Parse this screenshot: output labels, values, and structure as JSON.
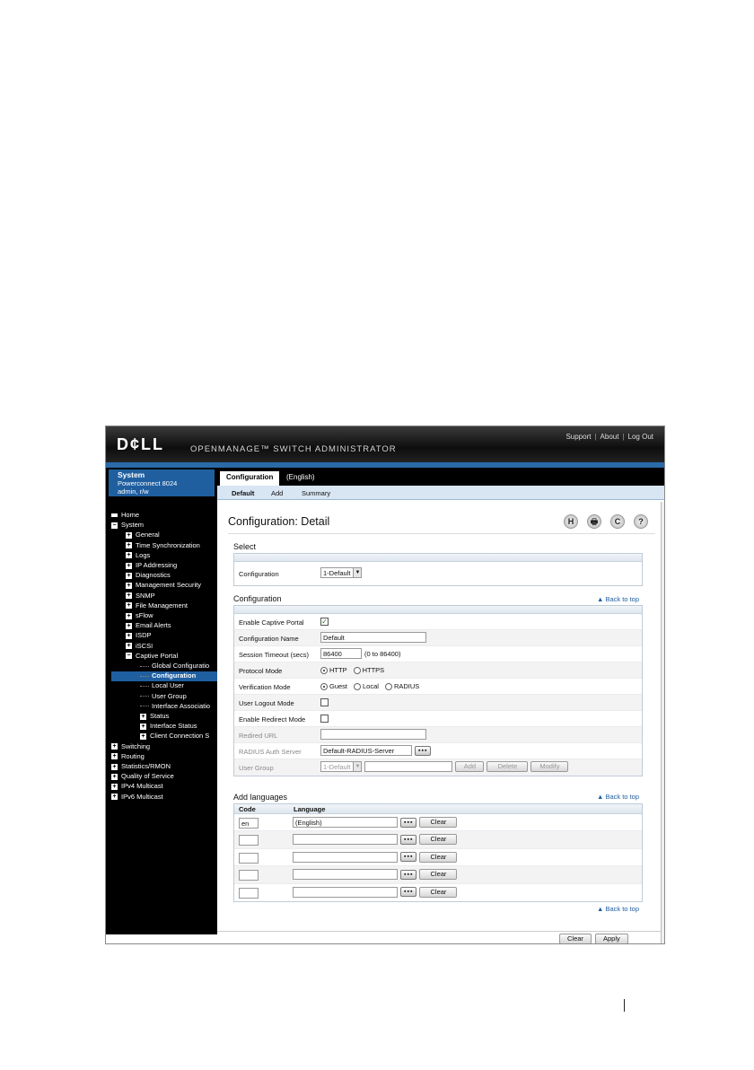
{
  "header": {
    "logo": "D¢LL",
    "product": "OPENMANAGE™ SWITCH ADMINISTRATOR",
    "links": [
      "Support",
      "About",
      "Log Out"
    ]
  },
  "system": {
    "title": "System",
    "model": "Powerconnect 8024",
    "user": "admin, r/w"
  },
  "nav": [
    {
      "label": "Home",
      "level": 0,
      "icon": "home-icon"
    },
    {
      "label": "System",
      "level": 0,
      "icon": "minus"
    },
    {
      "label": "General",
      "level": 1,
      "icon": "plus"
    },
    {
      "label": "Time Synchronization",
      "level": 1,
      "icon": "plus"
    },
    {
      "label": "Logs",
      "level": 1,
      "icon": "plus"
    },
    {
      "label": "IP Addressing",
      "level": 1,
      "icon": "plus"
    },
    {
      "label": "Diagnostics",
      "level": 1,
      "icon": "plus"
    },
    {
      "label": "Management Security",
      "level": 1,
      "icon": "plus"
    },
    {
      "label": "SNMP",
      "level": 1,
      "icon": "plus"
    },
    {
      "label": "File Management",
      "level": 1,
      "icon": "plus"
    },
    {
      "label": "sFlow",
      "level": 1,
      "icon": "plus"
    },
    {
      "label": "Email Alerts",
      "level": 1,
      "icon": "plus"
    },
    {
      "label": "ISDP",
      "level": 1,
      "icon": "plus"
    },
    {
      "label": "iSCSI",
      "level": 1,
      "icon": "plus"
    },
    {
      "label": "Captive Portal",
      "level": 1,
      "icon": "minus"
    },
    {
      "label": "Global Configuratio",
      "level": 2,
      "icon": "none"
    },
    {
      "label": "Configuration",
      "level": 2,
      "icon": "none",
      "selected": true
    },
    {
      "label": "Local User",
      "level": 2,
      "icon": "none"
    },
    {
      "label": "User Group",
      "level": 2,
      "icon": "none"
    },
    {
      "label": "Interface Associatio",
      "level": 2,
      "icon": "none"
    },
    {
      "label": "Status",
      "level": 2,
      "icon": "plus"
    },
    {
      "label": "Interface Status",
      "level": 2,
      "icon": "plus"
    },
    {
      "label": "Client Connection S",
      "level": 2,
      "icon": "plus"
    },
    {
      "label": "Switching",
      "level": 0,
      "icon": "plus"
    },
    {
      "label": "Routing",
      "level": 0,
      "icon": "plus"
    },
    {
      "label": "Statistics/RMON",
      "level": 0,
      "icon": "plus"
    },
    {
      "label": "Quality of Service",
      "level": 0,
      "icon": "plus"
    },
    {
      "label": "IPv4 Multicast",
      "level": 0,
      "icon": "plus"
    },
    {
      "label": "IPv6 Multicast",
      "level": 0,
      "icon": "plus"
    }
  ],
  "tabs": [
    "Configuration",
    "(English)"
  ],
  "subtabs": [
    "Default",
    "Add",
    "Summary"
  ],
  "page_title": "Configuration: Detail",
  "toolbar_icons": [
    "H",
    "🖶",
    "C",
    "?"
  ],
  "select_section": {
    "title": "Select",
    "config_label": "Configuration",
    "config_value": "1-Default"
  },
  "config_section": {
    "title": "Configuration",
    "back_to_top": "Back to top",
    "enable_captive_portal": "Enable Captive Portal",
    "config_name_label": "Configuration Name",
    "config_name_value": "Default",
    "session_timeout_label": "Session Timeout (secs)",
    "session_timeout_value": "86400",
    "session_timeout_range": "(0 to 86400)",
    "protocol_mode_label": "Protocol Mode",
    "protocol_options": [
      "HTTP",
      "HTTPS"
    ],
    "verification_mode_label": "Verification Mode",
    "verification_options": [
      "Guest",
      "Local",
      "RADIUS"
    ],
    "user_logout_label": "User Logout Mode",
    "enable_redirect_label": "Enable Redirect Mode",
    "redirect_url_label": "Redired URL",
    "radius_label": "RADIUS Auth Server",
    "radius_value": "Default-RADIUS-Server",
    "user_group_label": "User Group",
    "user_group_value": "1-Default",
    "user_group_buttons": [
      "Add",
      "Delete",
      "Modify"
    ]
  },
  "languages_section": {
    "title": "Add languages",
    "back_to_top": "Back to top",
    "col_code": "Code",
    "col_language": "Language",
    "rows": [
      {
        "code": "en",
        "language": "(English)"
      },
      {
        "code": "",
        "language": ""
      },
      {
        "code": "",
        "language": ""
      },
      {
        "code": "",
        "language": ""
      },
      {
        "code": "",
        "language": ""
      }
    ],
    "dots_label": "▪▪▪",
    "clear_label": "Clear",
    "back_to_top_bottom": "Back to top"
  },
  "footer": {
    "clear": "Clear",
    "apply": "Apply"
  }
}
